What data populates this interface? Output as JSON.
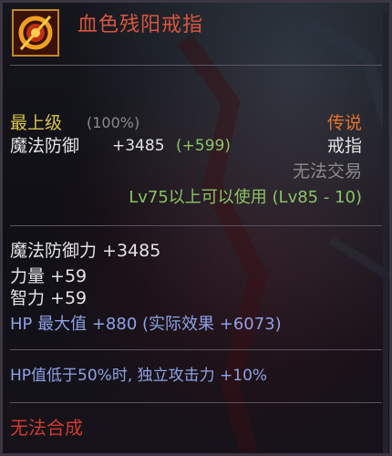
{
  "item": {
    "name": "血色残阳戒指",
    "icon": "blood-sunset-ring-icon"
  },
  "grade": {
    "label": "最上级",
    "percent": "(100%)"
  },
  "rarity": "传说",
  "slot": "戒指",
  "trade": "无法交易",
  "main_stat": {
    "label": "魔法防御",
    "value": "+3485",
    "bonus": "(+599)"
  },
  "level_req": "Lv75以上可以使用 (Lv85 - 10)",
  "stats": [
    "魔法防御力 +3485",
    "力量 +59",
    "智力 +59"
  ],
  "hp_line": "HP 最大值 +880 (实际效果 +6073)",
  "special": "HP值低于50%时, 独立攻击力 +10%",
  "footer": "无法合成",
  "colors": {
    "title": "#d7563e",
    "grade": "#d7c348",
    "rarity": "#e1732f",
    "green": "#8ac463",
    "blue": "#8da2e6",
    "red": "#d03a2c"
  }
}
